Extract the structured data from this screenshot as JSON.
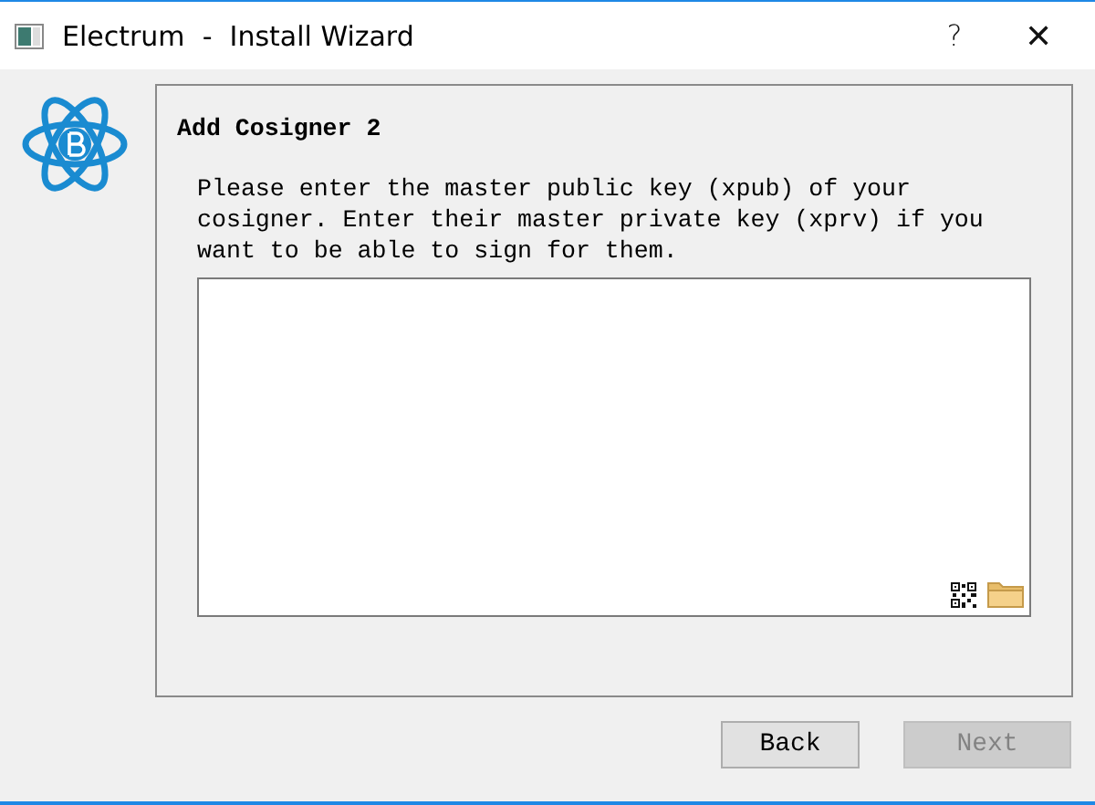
{
  "window": {
    "title": "Electrum  -  Install Wizard",
    "help": "?",
    "close": "✕"
  },
  "page": {
    "heading": "Add Cosigner 2",
    "message": "Please enter the master public key (xpub) of your cosigner. Enter their master private key (xprv) if you want to be able to sign for them."
  },
  "buttons": [
    {
      "label": "Back",
      "disabled": false
    },
    {
      "label": "Next",
      "disabled": true
    }
  ]
}
